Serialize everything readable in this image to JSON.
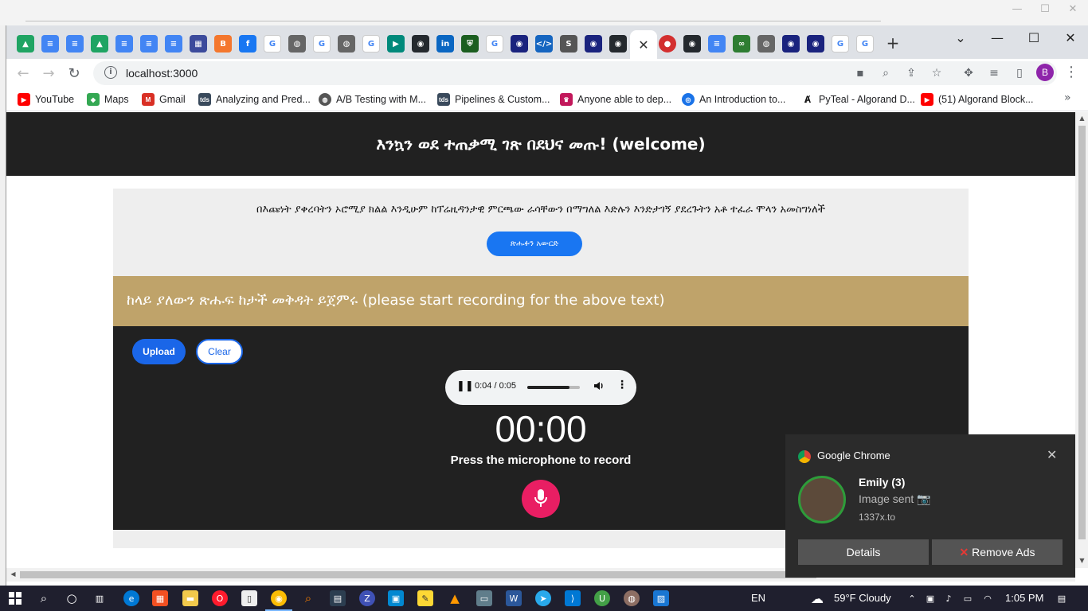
{
  "browser": {
    "url": "localhost:3000",
    "profile_initial": "B",
    "window_controls": [
      "⌄",
      "—",
      "☐",
      "✕"
    ],
    "bookmarks": [
      {
        "label": "YouTube",
        "icon": "youtube-icon",
        "color": "#ff0000"
      },
      {
        "label": "Maps",
        "icon": "maps-icon",
        "color": "#34a853"
      },
      {
        "label": "Gmail",
        "icon": "gmail-icon",
        "color": "#d93025"
      },
      {
        "label": "Analyzing and Pred...",
        "icon": "tds-icon",
        "color": "#3a4a5c"
      },
      {
        "label": "A/B Testing with M...",
        "icon": "globe-icon",
        "color": "#555555"
      },
      {
        "label": "Pipelines & Custom...",
        "icon": "tds-icon",
        "color": "#3a4a5c"
      },
      {
        "label": "Anyone able to dep...",
        "icon": "crown-icon",
        "color": "#c2185b"
      },
      {
        "label": "An Introduction to...",
        "icon": "fingerprint-icon",
        "color": "#1a73e8"
      },
      {
        "label": "PyTeal - Algorand D...",
        "icon": "algorand-icon",
        "color": "#111111"
      },
      {
        "label": "(51) Algorand Block...",
        "icon": "youtube-icon",
        "color": "#ff0000"
      }
    ]
  },
  "page": {
    "header_title": "እንኳን ወደ ተጠቃሚ ገጽ በደህና መጡ! (welcome)",
    "sentence": "በእጩነት ያቀረባትን ኦሮሚያ ክልል እንዲሁም ከፕሬዚዳንታዊ ምርጫው ራሳቸውን በማግለል እድሉን እንድታገኝ ያደረጉትን አቶ ተፈራ ሞላን አመስግነለች",
    "change_text_button": "ጽሑፉን አውርድ",
    "instruction": "ከላይ ያለውን ጽሑፍ ከታች መቅዳት ይጀምሩ (please start recording for the above text)",
    "upload_button": "Upload",
    "clear_button": "Clear",
    "audio": {
      "time": "0:04 / 0:05",
      "progress": 0.8
    },
    "timer": "00:00",
    "mic_hint": "Press the microphone to record",
    "accent_pink": "#e91e63",
    "accent_blue": "#1976f2",
    "bar_gold": "#bfa36a"
  },
  "notification": {
    "app": "Google Chrome",
    "sender": "Emily (3)",
    "message": "Image sent 📷",
    "source": "1337x.to",
    "details_button": "Details",
    "remove_button": "Remove Ads"
  },
  "taskbar": {
    "language": "EN",
    "weather": "59°F  Cloudy",
    "time": "1:05 PM"
  }
}
